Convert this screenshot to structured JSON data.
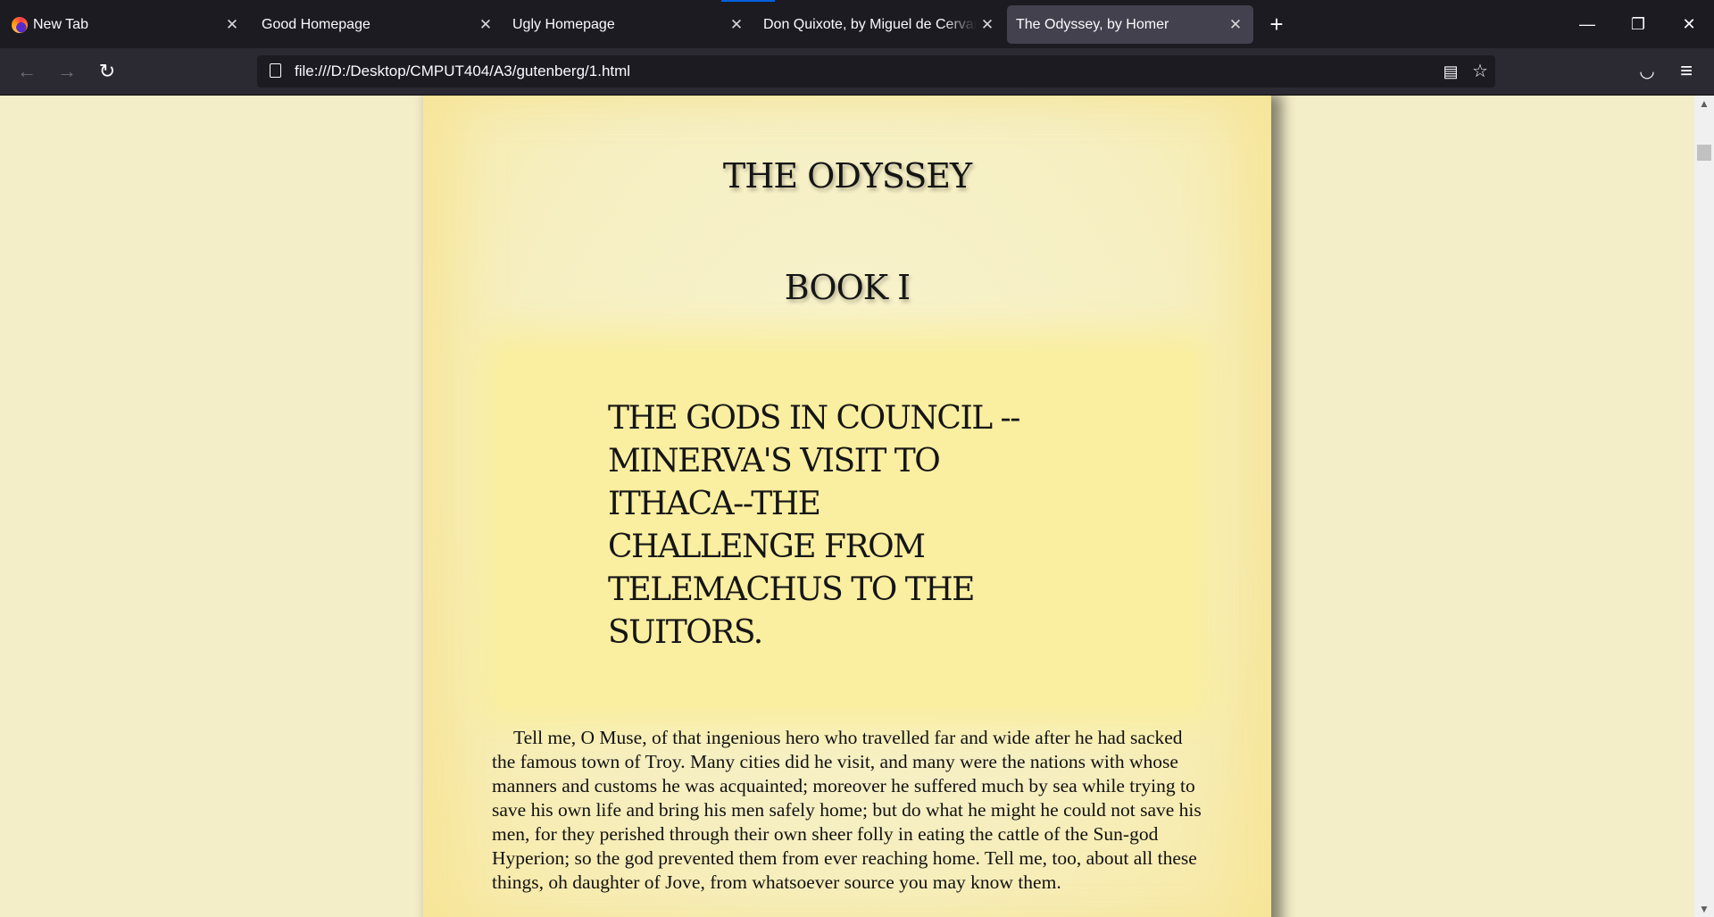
{
  "browser": {
    "tabs": [
      {
        "label": "New Tab",
        "favicon": "firefox-icon"
      },
      {
        "label": "Good Homepage"
      },
      {
        "label": "Ugly Homepage"
      },
      {
        "label": "Don Quixote, by Miguel de Cervantes"
      },
      {
        "label": "The Odyssey, by Homer",
        "active": true
      }
    ],
    "close_glyph": "✕",
    "new_tab_glyph": "+",
    "window": {
      "minimize": "—",
      "restore": "❐",
      "close": "✕"
    },
    "nav": {
      "back": "←",
      "forward": "→",
      "reload": "↻"
    },
    "url": "file:///D:/Desktop/CMPUT404/A3/gutenberg/1.html",
    "url_icons": {
      "reader": "▤",
      "bookmark": "☆"
    },
    "toolbar": {
      "pocket": "◡",
      "menu": "≡"
    }
  },
  "page": {
    "title": "THE ODYSSEY",
    "book": "BOOK I",
    "summary": "THE GODS IN COUNCIL --MINERVA'S VISIT TO ITHACA--THE CHALLENGE FROM TELEMACHUS TO THE SUITORS.",
    "paragraph": "Tell me, O Muse, of that ingenious hero who travelled far and wide after he had sacked the famous town of Troy. Many cities did he visit, and many were the nations with whose manners and customs he was acquainted; moreover he suffered much by sea while trying to save his own life and bring his men safely home; but do what he might he could not save his men, for they perished through their own sheer folly in eating the cattle of the Sun-god Hyperion; so the god prevented them from ever reaching home. Tell me, too, about all these things, oh daughter of Jove, from whatsoever source you may know them."
  },
  "scrollbar": {
    "up": "▲",
    "down": "▼"
  }
}
